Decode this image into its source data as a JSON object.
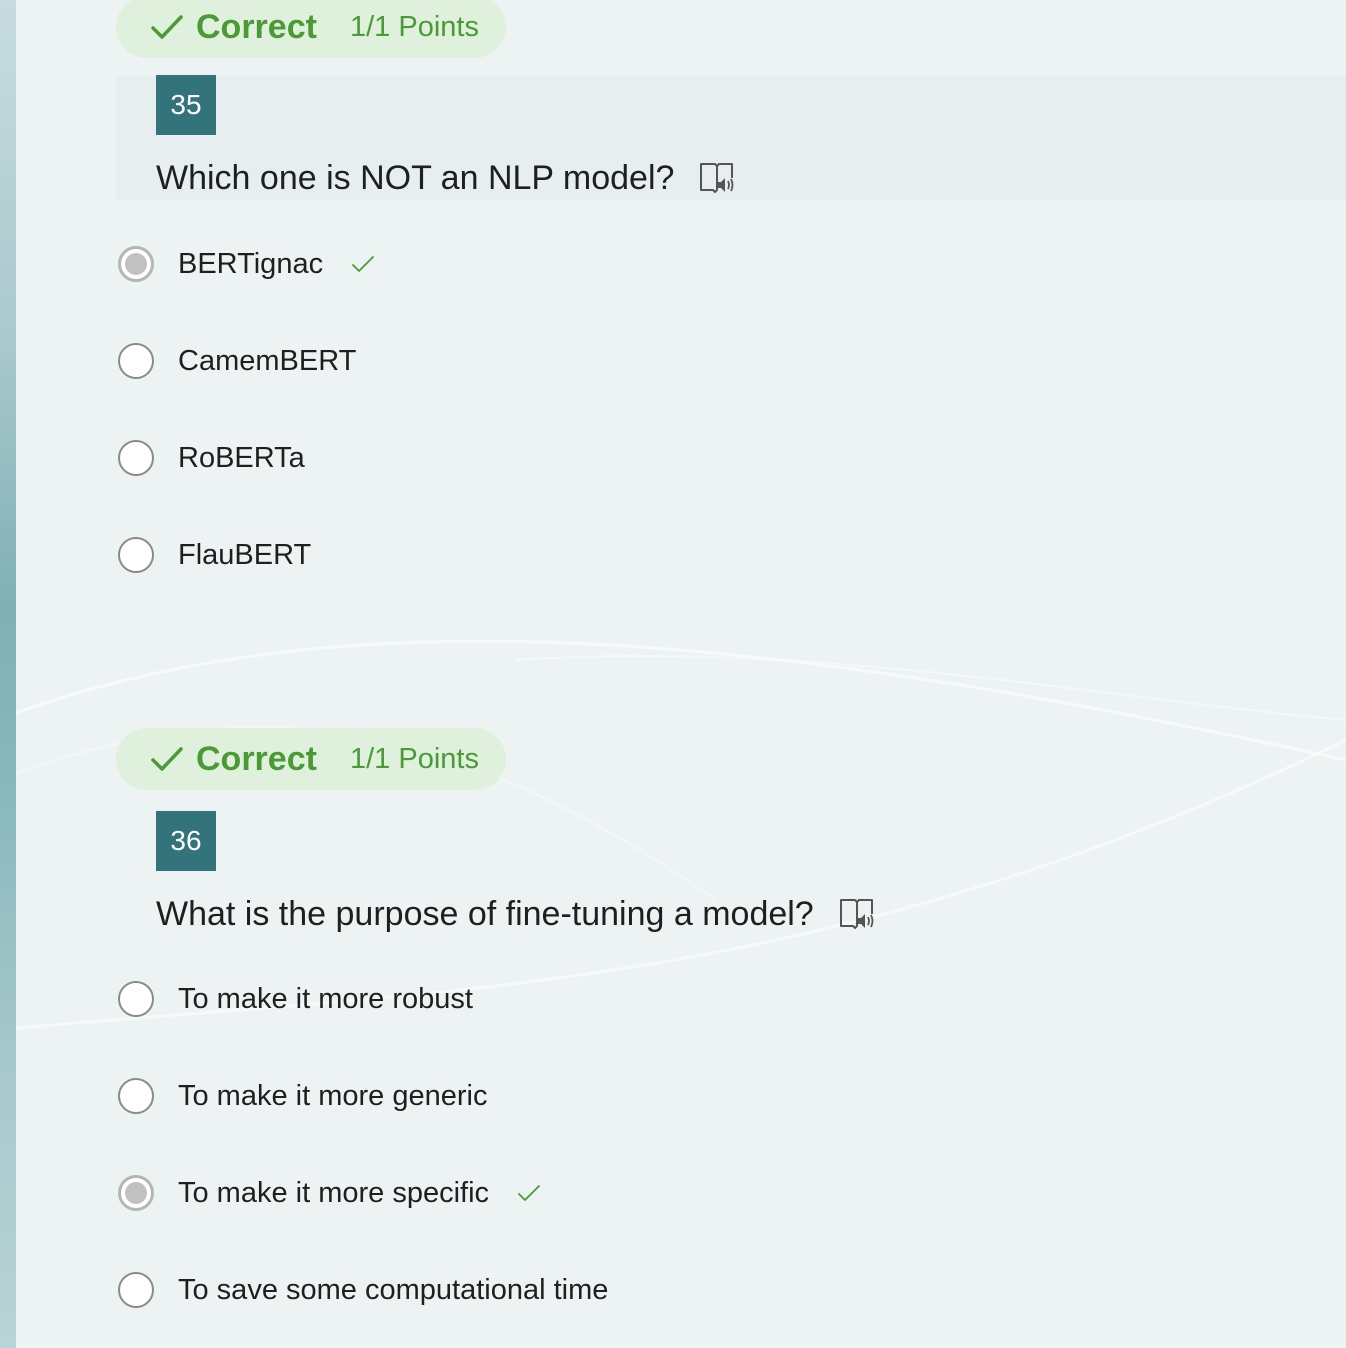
{
  "colors": {
    "correct_green": "#4a9a36",
    "badge_bg": "#dff0dc",
    "question_number_bg": "#33737a"
  },
  "questions": [
    {
      "status": "Correct",
      "points": "1/1 Points",
      "number": "35",
      "text": "Which one is NOT an NLP model?",
      "reader_icon": "immersive-reader-icon",
      "options": [
        {
          "label": "BERTignac",
          "selected": true,
          "correct": true
        },
        {
          "label": "CamemBERT",
          "selected": false,
          "correct": false
        },
        {
          "label": "RoBERTa",
          "selected": false,
          "correct": false
        },
        {
          "label": "FlauBERT",
          "selected": false,
          "correct": false
        }
      ]
    },
    {
      "status": "Correct",
      "points": "1/1 Points",
      "number": "36",
      "text": "What is the purpose of fine-tuning a model?",
      "reader_icon": "immersive-reader-icon",
      "options": [
        {
          "label": "To make it more robust",
          "selected": false,
          "correct": false
        },
        {
          "label": "To make it more generic",
          "selected": false,
          "correct": false
        },
        {
          "label": "To make it more specific",
          "selected": true,
          "correct": true
        },
        {
          "label": "To save some computational time",
          "selected": false,
          "correct": false
        }
      ]
    }
  ]
}
